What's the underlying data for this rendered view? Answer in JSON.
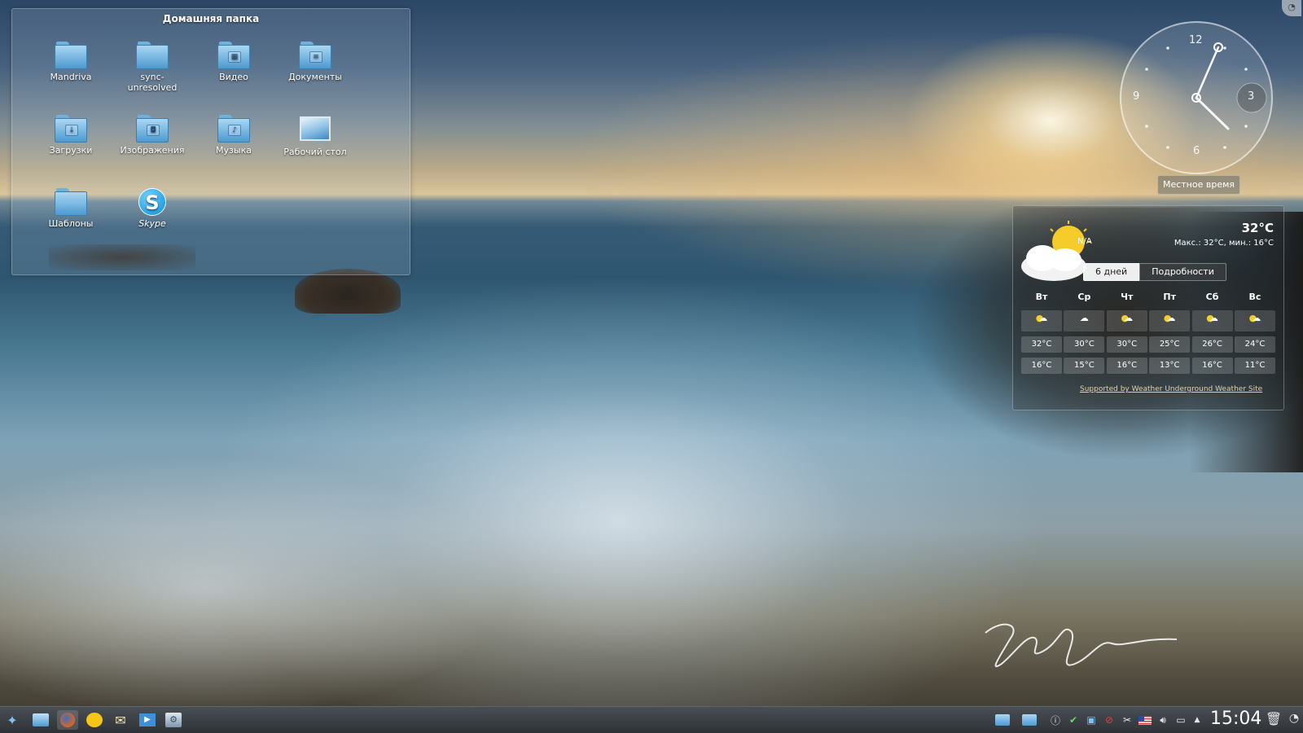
{
  "folderview": {
    "title": "Домашняя папка",
    "items": [
      {
        "label": "Mandriva",
        "icon": "folder-icon"
      },
      {
        "label": "sync-\nunresolved",
        "icon": "folder-icon"
      },
      {
        "label": "Видео",
        "icon": "folder-videos-icon"
      },
      {
        "label": "Документы",
        "icon": "folder-documents-icon"
      },
      {
        "label": "Загрузки",
        "icon": "folder-downloads-icon"
      },
      {
        "label": "Изображения",
        "icon": "folder-pictures-icon"
      },
      {
        "label": "Музыка",
        "icon": "folder-music-icon"
      },
      {
        "label": "Рабочий стол",
        "icon": "desktop-folder-icon"
      },
      {
        "label": "Шаблоны",
        "icon": "folder-templates-icon"
      },
      {
        "label": "Skype",
        "icon": "skype-icon"
      }
    ]
  },
  "clock": {
    "numbers": {
      "twelve": "12",
      "three": "3",
      "six": "6",
      "nine": "9"
    },
    "label": "Местное время",
    "time_shown": "15:04"
  },
  "weather": {
    "current_temp": "32°C",
    "min_max": "Макс.: 32°C, мин.: 16°C",
    "na_badge": "N/A",
    "tabs": [
      {
        "label": "6 дней",
        "active": true
      },
      {
        "label": "Подробности",
        "active": false
      }
    ],
    "days": [
      "Вт",
      "Ср",
      "Чт",
      "Пт",
      "Сб",
      "Вс"
    ],
    "highs": [
      "32°C",
      "30°C",
      "30°C",
      "25°C",
      "26°C",
      "24°C"
    ],
    "lows": [
      "16°C",
      "15°C",
      "16°C",
      "13°C",
      "16°C",
      "11°C"
    ],
    "credit": "Supported by Weather Underground Weather Site"
  },
  "taskbar": {
    "launchers": [
      "kickoff-menu-icon",
      "file-manager-icon",
      "firefox-icon",
      "chat-icon",
      "mail-icon",
      "media-player-icon",
      "system-settings-icon"
    ],
    "tray": [
      "folder-icon",
      "folder-icon",
      "info-icon",
      "check-icon",
      "network-icon",
      "update-icon",
      "scissors-icon",
      "us-flag-icon",
      "volume-icon",
      "monitor-icon",
      "expand-arrow-icon"
    ],
    "clock": "15:04"
  },
  "colors": {
    "accent": "#4d9ad0",
    "taskbar": "#2e3236"
  }
}
